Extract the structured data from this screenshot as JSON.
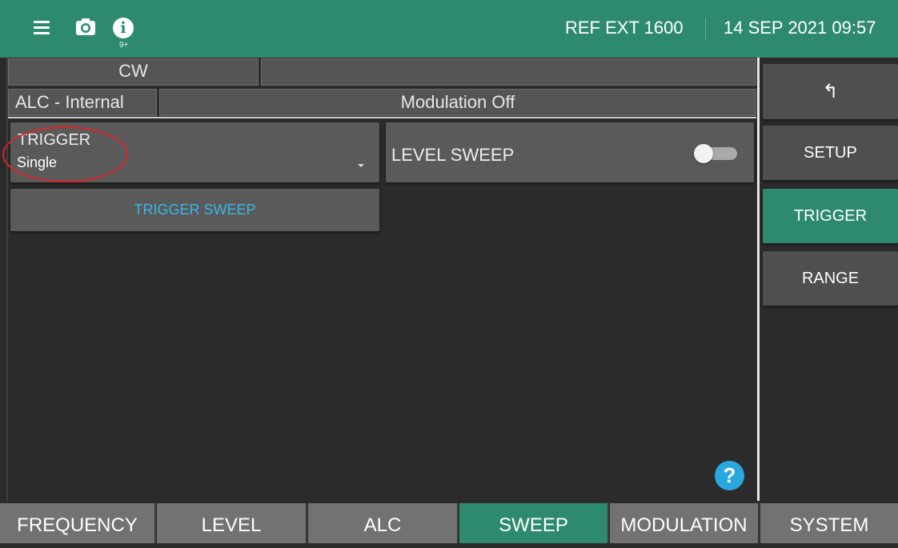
{
  "topbar": {
    "menu_icon": "menu-icon",
    "camera_icon": "camera-icon",
    "info_icon": "info-icon",
    "info_symbol": "i",
    "notification_count": "9+",
    "reference": "REF EXT 1600",
    "datetime": "14 SEP 2021 09:57"
  },
  "status": {
    "mode": "CW",
    "alc": "ALC - Internal",
    "modulation": "Modulation Off"
  },
  "trigger": {
    "label": "TRIGGER",
    "value": "Single"
  },
  "level_sweep": {
    "label": "LEVEL SWEEP",
    "enabled": false
  },
  "trigger_sweep_button": "TRIGGER SWEEP",
  "help_symbol": "?",
  "side_menu": {
    "back_symbol": "↰",
    "items": [
      "SETUP",
      "TRIGGER",
      "RANGE"
    ],
    "active": "TRIGGER"
  },
  "tabs": [
    "FREQUENCY",
    "LEVEL",
    "ALC",
    "SWEEP",
    "MODULATION",
    "SYSTEM"
  ],
  "active_tab": "SWEEP",
  "colors": {
    "accent": "#2e8a6e",
    "link": "#3ab5e6",
    "annotation": "#d9262a"
  }
}
